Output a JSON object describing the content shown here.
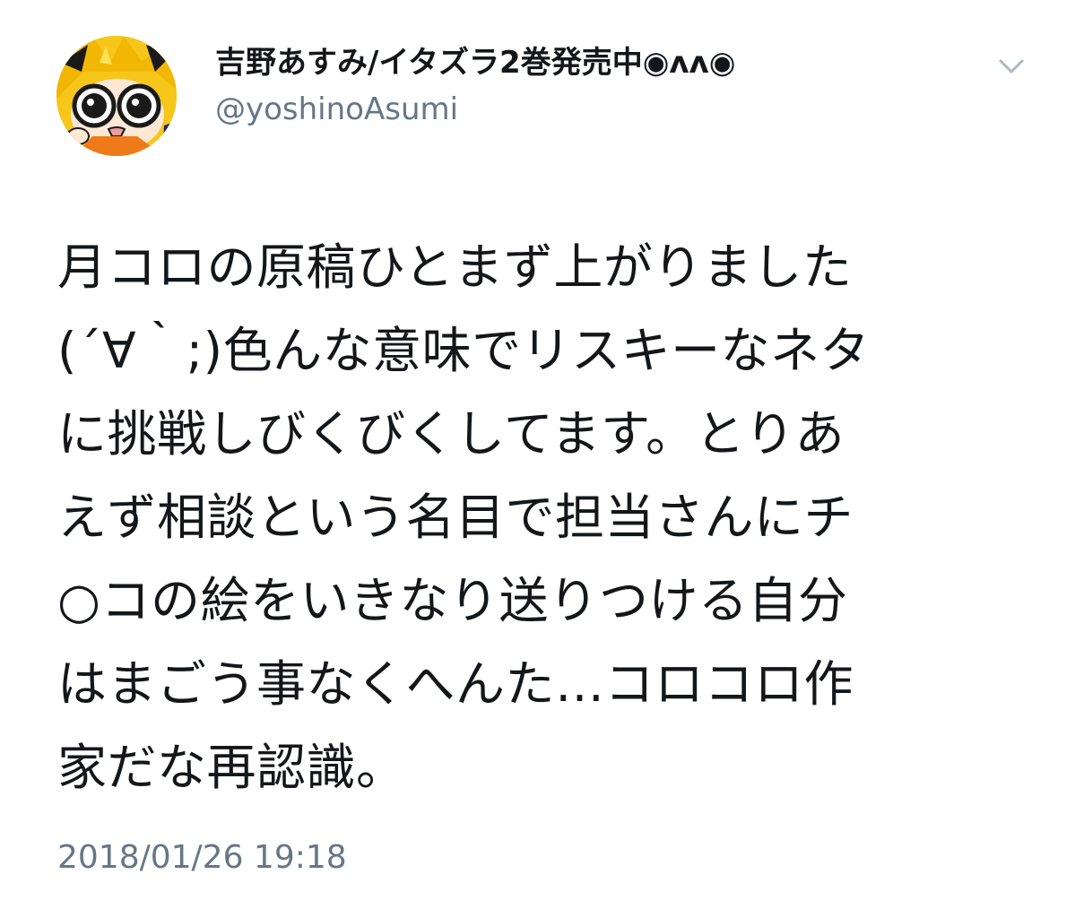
{
  "author": {
    "display_name": "吉野あすみ/イタズラ2巻発売中◉ʌʌ◉",
    "handle": "@yoshinoAsumi",
    "avatar_icon": "cartoon-character-avatar-icon"
  },
  "menu": {
    "icon": "chevron-down-icon"
  },
  "tweet": {
    "lines": [
      "月コロの原稿ひとまず上がりました",
      "(´∀｀;)色んな意味でリスキーなネタ",
      "に挑戦しびくびくしてます。とりあ",
      "えず相談という名目で担当さんにチ",
      "○コの絵をいきなり送りつける自分",
      "はまごう事なくへんた…コロコロ作",
      "家だな再認識。"
    ],
    "timestamp": "2018/01/26 19:18"
  },
  "colors": {
    "text_primary": "#14171a",
    "text_secondary": "#657786",
    "chevron": "#aab8c2",
    "avatar_bg": "#f6c61a"
  }
}
